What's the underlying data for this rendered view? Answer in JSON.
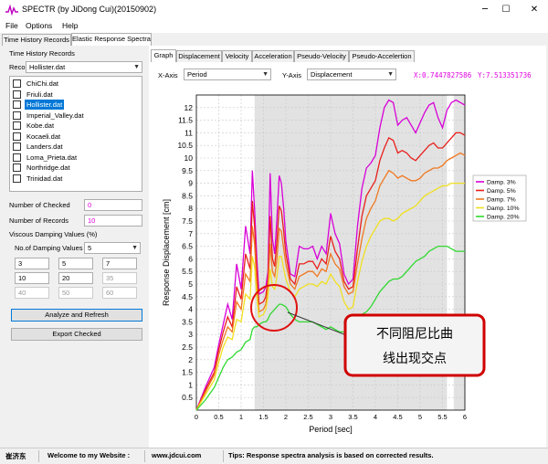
{
  "window": {
    "title": "SPECTR (by JiDong Cui)(20150902)",
    "minimize": "─",
    "maximize": "☐",
    "close": "✕"
  },
  "menu": [
    "File",
    "Options",
    "Help"
  ],
  "main_tabs": [
    "Time History Records",
    "Elastic Response Spectra"
  ],
  "left": {
    "group_title": "Time History Records",
    "record_label": "Record",
    "record_value": "Hollister.dat",
    "records": [
      {
        "name": "ChiChi.dat",
        "selected": false
      },
      {
        "name": "Friuli.dat",
        "selected": false
      },
      {
        "name": "Hollister.dat",
        "selected": true
      },
      {
        "name": "Imperial_Valley.dat",
        "selected": false
      },
      {
        "name": "Kobe.dat",
        "selected": false
      },
      {
        "name": "Kocaeli.dat",
        "selected": false
      },
      {
        "name": "Landers.dat",
        "selected": false
      },
      {
        "name": "Loma_Prieta.dat",
        "selected": false
      },
      {
        "name": "Northridge.dat",
        "selected": false
      },
      {
        "name": "Trinidad.dat",
        "selected": false
      }
    ],
    "num_checked_label": "Number of Checked",
    "num_checked_value": "0",
    "num_records_label": "Number of Records",
    "num_records_value": "10",
    "damping_group_title": "Viscous Damping Values (%)",
    "num_damping_label": "No.of Damping Values",
    "num_damping_value": "5",
    "damping_values": [
      "3",
      "5",
      "7",
      "10",
      "20",
      "35",
      "40",
      "50",
      "60"
    ],
    "analyze_button": "Analyze and Refresh",
    "export_button": "Export Checked"
  },
  "right": {
    "tabs": [
      "Graph",
      "Displacement",
      "Velocity",
      "Acceleration",
      "Pseudo-Velocity",
      "Pseudo-Accelertion"
    ],
    "x_axis_label": "X-Axis",
    "x_axis_value": "Period",
    "y_axis_label": "Y-Axis",
    "y_axis_value": "Displacement",
    "x_readout": "X:0.7447827586",
    "y_readout": "Y:7.513351736"
  },
  "annotation": {
    "line1": "不同阻尼比曲",
    "line2": "线出现交点"
  },
  "status": {
    "author": "崔济东",
    "welcome": "Welcome to my Website :",
    "website": "www.jdcui.com",
    "tips": "Tips: Response spectra analysis is based on corrected results."
  },
  "chart_data": {
    "type": "line",
    "xlabel": "Period [sec]",
    "ylabel": "Response Displacement [cm]",
    "xlim": [
      0,
      6
    ],
    "ylim": [
      0,
      12.5
    ],
    "xticks": [
      "0",
      "0.5",
      "1",
      "1.5",
      "2",
      "2.5",
      "3",
      "3.5",
      "4",
      "4.5",
      "5",
      "5.5",
      "6"
    ],
    "yticks": [
      "0.5",
      "1",
      "1.5",
      "2",
      "2.5",
      "3",
      "3.5",
      "4",
      "4.5",
      "5",
      "5.5",
      "6",
      "6.5",
      "7",
      "7.5",
      "8",
      "8.5",
      "9",
      "9.5",
      "10",
      "10.5",
      "11",
      "11.5",
      "12"
    ],
    "shaded_ranges": [
      [
        1.3,
        5.6
      ],
      [
        5.75,
        6
      ]
    ],
    "legend_position": "top-right",
    "series": [
      {
        "name": "Damp. 3%",
        "color": "#d800d8",
        "x": [
          0,
          0.2,
          0.4,
          0.5,
          0.6,
          0.7,
          0.8,
          0.9,
          1.0,
          1.1,
          1.2,
          1.25,
          1.3,
          1.35,
          1.4,
          1.5,
          1.55,
          1.6,
          1.65,
          1.7,
          1.75,
          1.8,
          1.85,
          1.9,
          1.95,
          2.0,
          2.1,
          2.2,
          2.3,
          2.4,
          2.5,
          2.6,
          2.7,
          2.8,
          2.9,
          3.0,
          3.1,
          3.2,
          3.3,
          3.4,
          3.5,
          3.6,
          3.7,
          3.8,
          3.9,
          4.0,
          4.1,
          4.2,
          4.3,
          4.4,
          4.5,
          4.6,
          4.7,
          4.8,
          4.9,
          5.0,
          5.1,
          5.2,
          5.3,
          5.4,
          5.5,
          5.6,
          5.7,
          5.8,
          5.9,
          6.0
        ],
        "y": [
          0,
          0.9,
          1.7,
          2.6,
          3.4,
          4.2,
          3.6,
          5.8,
          4.8,
          7.3,
          6.2,
          9.5,
          8.0,
          6.0,
          4.6,
          4.7,
          4.9,
          5.5,
          9.4,
          6.8,
          6.2,
          7.6,
          9.3,
          9.0,
          8.0,
          6.7,
          5.4,
          5.3,
          6.5,
          6.4,
          6.4,
          6.5,
          6.0,
          6.5,
          6.2,
          7.8,
          7.0,
          6.6,
          5.4,
          5.0,
          5.2,
          7.3,
          8.8,
          9.6,
          9.8,
          10.1,
          11.2,
          12.0,
          12.3,
          12.2,
          11.3,
          11.5,
          11.6,
          11.3,
          11.0,
          11.4,
          11.8,
          12.1,
          12.2,
          11.6,
          11.2,
          11.9,
          12.2,
          12.3,
          12.2,
          12.1
        ]
      },
      {
        "name": "Damp. 5%",
        "color": "#e8201c",
        "x": [
          0,
          0.2,
          0.4,
          0.5,
          0.6,
          0.7,
          0.8,
          0.9,
          1.0,
          1.1,
          1.2,
          1.25,
          1.3,
          1.35,
          1.4,
          1.5,
          1.55,
          1.6,
          1.65,
          1.7,
          1.75,
          1.8,
          1.85,
          1.9,
          1.95,
          2.0,
          2.1,
          2.2,
          2.3,
          2.4,
          2.5,
          2.6,
          2.7,
          2.8,
          2.9,
          3.0,
          3.1,
          3.2,
          3.3,
          3.4,
          3.5,
          3.6,
          3.7,
          3.8,
          3.9,
          4.0,
          4.1,
          4.2,
          4.3,
          4.4,
          4.5,
          4.6,
          4.7,
          4.8,
          4.9,
          5.0,
          5.1,
          5.2,
          5.3,
          5.4,
          5.5,
          5.6,
          5.7,
          5.8,
          5.9,
          6.0
        ],
        "y": [
          0,
          0.8,
          1.5,
          2.4,
          3.1,
          3.7,
          3.3,
          4.9,
          4.4,
          6.2,
          5.6,
          8.3,
          7.3,
          5.5,
          4.2,
          4.3,
          4.5,
          5.2,
          7.7,
          6.0,
          5.7,
          6.7,
          8.1,
          7.9,
          7.1,
          6.2,
          5.2,
          5.0,
          5.8,
          5.8,
          5.9,
          5.9,
          5.6,
          6.0,
          5.8,
          6.9,
          6.3,
          6.0,
          5.1,
          4.8,
          4.9,
          6.4,
          7.7,
          8.5,
          8.8,
          9.1,
          9.9,
          10.4,
          10.8,
          10.7,
          10.2,
          10.3,
          10.2,
          10.0,
          9.9,
          10.1,
          10.3,
          10.5,
          10.6,
          10.4,
          10.4,
          10.6,
          10.8,
          11.0,
          11.0,
          10.9
        ]
      },
      {
        "name": "Damp. 7%",
        "color": "#f07820",
        "x": [
          0,
          0.2,
          0.4,
          0.5,
          0.6,
          0.7,
          0.8,
          0.9,
          1.0,
          1.1,
          1.2,
          1.25,
          1.3,
          1.35,
          1.4,
          1.5,
          1.55,
          1.6,
          1.65,
          1.7,
          1.75,
          1.8,
          1.85,
          1.9,
          1.95,
          2.0,
          2.1,
          2.2,
          2.3,
          2.4,
          2.5,
          2.6,
          2.7,
          2.8,
          2.9,
          3.0,
          3.1,
          3.2,
          3.3,
          3.4,
          3.5,
          3.6,
          3.7,
          3.8,
          3.9,
          4.0,
          4.1,
          4.2,
          4.3,
          4.4,
          4.5,
          4.6,
          4.7,
          4.8,
          4.9,
          5.0,
          5.1,
          5.2,
          5.3,
          5.4,
          5.5,
          5.6,
          5.7,
          5.8,
          5.9,
          6.0
        ],
        "y": [
          0,
          0.7,
          1.4,
          2.2,
          2.8,
          3.3,
          3.1,
          4.3,
          4.0,
          5.4,
          5.1,
          7.3,
          6.6,
          5.0,
          3.9,
          4.0,
          4.2,
          4.9,
          6.6,
          5.5,
          5.3,
          6.0,
          7.2,
          7.1,
          6.4,
          5.8,
          5.0,
          4.8,
          5.3,
          5.4,
          5.5,
          5.5,
          5.3,
          5.6,
          5.5,
          6.2,
          5.8,
          5.6,
          4.9,
          4.6,
          4.7,
          5.8,
          6.8,
          7.6,
          8.0,
          8.3,
          8.9,
          9.2,
          9.5,
          9.4,
          9.2,
          9.3,
          9.2,
          9.1,
          9.1,
          9.2,
          9.4,
          9.5,
          9.6,
          9.6,
          9.7,
          9.9,
          10.0,
          10.1,
          10.2,
          10.1
        ]
      },
      {
        "name": "Damp. 10%",
        "color": "#f0e020",
        "x": [
          0,
          0.2,
          0.4,
          0.5,
          0.6,
          0.7,
          0.8,
          0.9,
          1.0,
          1.1,
          1.2,
          1.25,
          1.3,
          1.35,
          1.4,
          1.5,
          1.55,
          1.6,
          1.65,
          1.7,
          1.75,
          1.8,
          1.85,
          1.9,
          1.95,
          2.0,
          2.1,
          2.2,
          2.3,
          2.4,
          2.5,
          2.6,
          2.7,
          2.8,
          2.9,
          3.0,
          3.1,
          3.2,
          3.3,
          3.4,
          3.5,
          3.6,
          3.7,
          3.8,
          3.9,
          4.0,
          4.1,
          4.2,
          4.3,
          4.4,
          4.5,
          4.6,
          4.7,
          4.8,
          4.9,
          5.0,
          5.1,
          5.2,
          5.3,
          5.4,
          5.5,
          5.6,
          5.7,
          5.8,
          5.9,
          6.0
        ],
        "y": [
          0,
          0.6,
          1.2,
          1.9,
          2.5,
          2.9,
          2.8,
          3.6,
          3.5,
          4.6,
          4.4,
          6.1,
          5.7,
          4.5,
          3.7,
          3.8,
          4.0,
          4.5,
          5.6,
          4.9,
          4.8,
          5.3,
          6.1,
          6.1,
          5.6,
          5.2,
          4.7,
          4.5,
          4.8,
          4.9,
          5.0,
          5.0,
          4.9,
          5.1,
          5.0,
          5.4,
          5.1,
          4.9,
          4.3,
          4.0,
          4.1,
          5.1,
          5.9,
          6.5,
          6.9,
          7.2,
          7.5,
          7.6,
          7.6,
          7.5,
          7.6,
          7.8,
          7.9,
          8.0,
          8.1,
          8.3,
          8.5,
          8.6,
          8.7,
          8.8,
          8.9,
          8.9,
          9.0,
          9.0,
          9.0,
          9.0
        ]
      },
      {
        "name": "Damp. 20%",
        "color": "#30d830",
        "x": [
          0,
          0.2,
          0.4,
          0.5,
          0.6,
          0.7,
          0.8,
          0.9,
          1.0,
          1.1,
          1.2,
          1.25,
          1.3,
          1.35,
          1.4,
          1.5,
          1.55,
          1.6,
          1.65,
          1.7,
          1.75,
          1.8,
          1.85,
          1.9,
          1.95,
          2.0,
          2.1,
          2.2,
          2.3,
          2.4,
          2.5,
          2.6,
          2.7,
          2.8,
          2.9,
          3.0,
          3.1,
          3.2,
          3.3,
          3.4,
          3.5,
          3.6,
          3.7,
          3.8,
          3.9,
          4.0,
          4.1,
          4.2,
          4.3,
          4.4,
          4.5,
          4.6,
          4.7,
          4.8,
          4.9,
          5.0,
          5.1,
          5.2,
          5.3,
          5.4,
          5.5,
          5.6,
          5.7,
          5.8,
          5.9,
          6.0
        ],
        "y": [
          0,
          0.4,
          0.9,
          1.3,
          1.7,
          2.0,
          2.1,
          2.3,
          2.4,
          2.7,
          2.8,
          3.2,
          3.3,
          3.3,
          3.4,
          3.5,
          3.5,
          3.6,
          3.8,
          3.9,
          4.0,
          4.1,
          4.2,
          4.2,
          4.15,
          4.1,
          3.8,
          3.6,
          3.5,
          3.5,
          3.5,
          3.5,
          3.4,
          3.3,
          3.2,
          3.3,
          3.2,
          3.1,
          3.1,
          3.2,
          3.4,
          3.6,
          3.8,
          3.9,
          4.1,
          4.4,
          4.7,
          4.9,
          5.1,
          5.2,
          5.2,
          5.3,
          5.5,
          5.7,
          5.9,
          6.0,
          6.1,
          6.3,
          6.4,
          6.5,
          6.5,
          6.5,
          6.4,
          6.3,
          6.3,
          6.3
        ]
      }
    ]
  }
}
